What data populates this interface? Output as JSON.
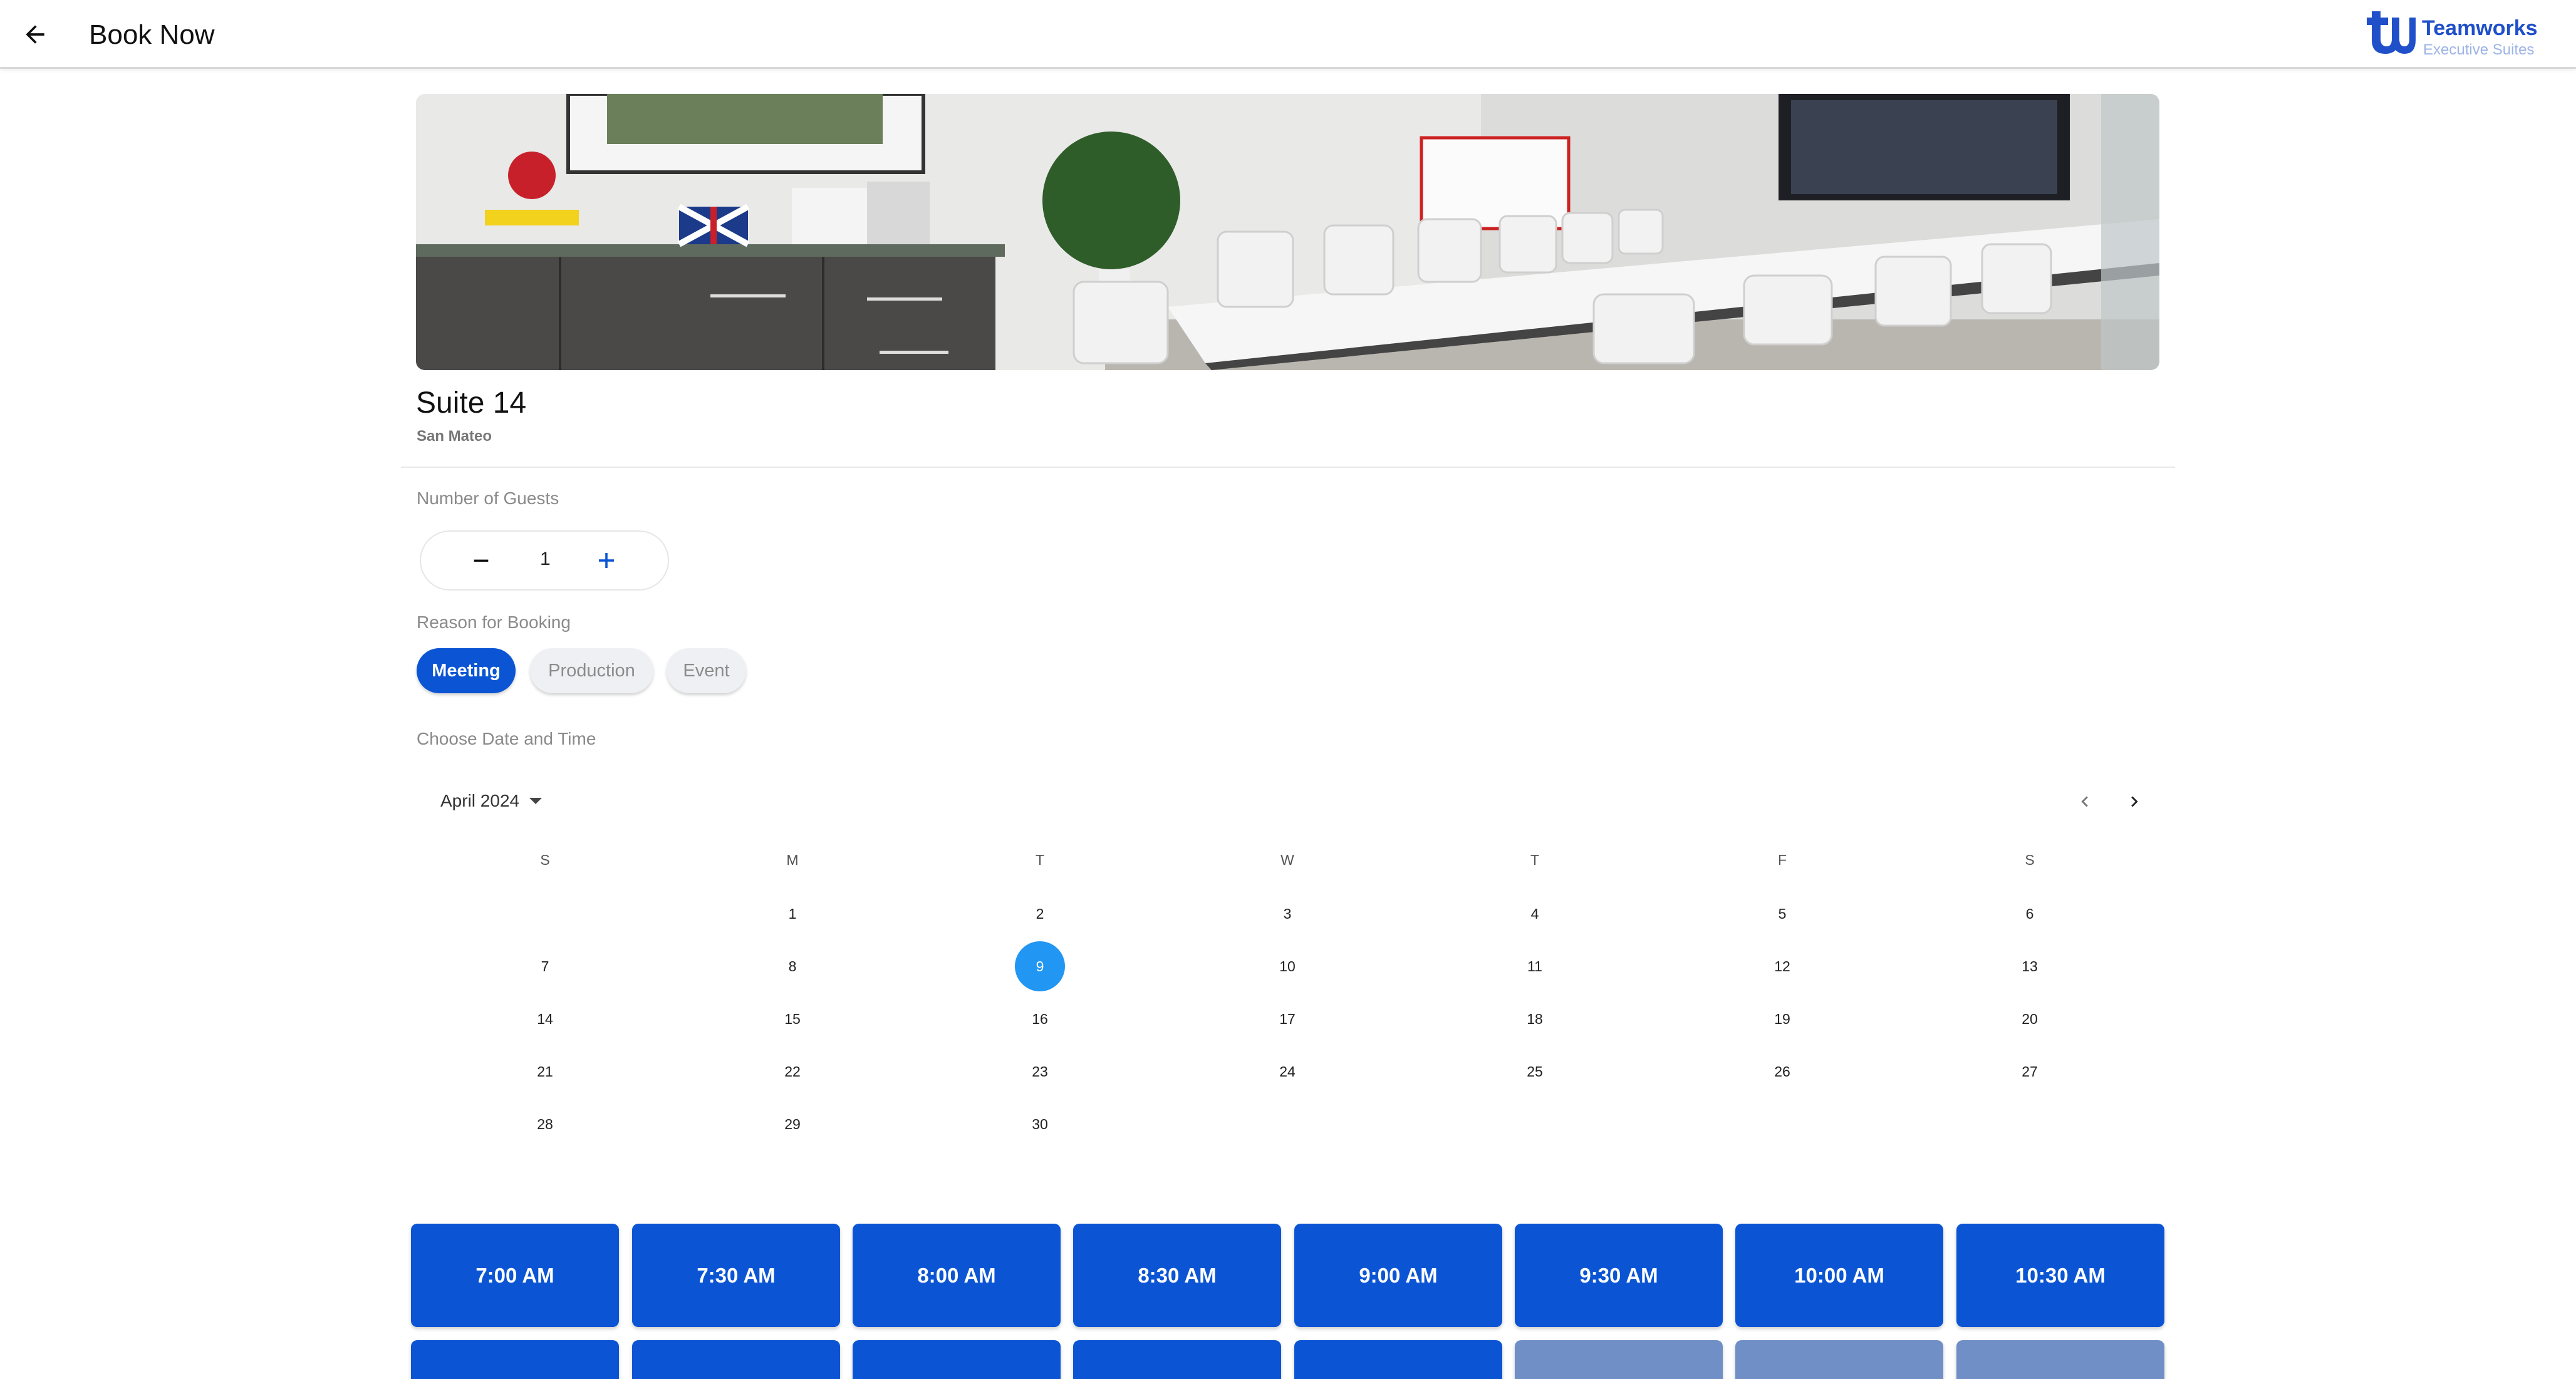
{
  "header": {
    "title": "Book Now",
    "back_icon": "arrow-left-icon",
    "logo": {
      "name": "Teamworks",
      "subtitle": "Executive Suites"
    }
  },
  "room": {
    "name": "Suite 14",
    "location": "San Mateo"
  },
  "guests": {
    "label": "Number of Guests",
    "value": "1"
  },
  "reason": {
    "label": "Reason for Booking",
    "options": [
      "Meeting",
      "Production",
      "Event"
    ],
    "selected": "Meeting"
  },
  "calendar": {
    "label": "Choose Date and Time",
    "month": "April 2024",
    "weekdays": [
      "S",
      "M",
      "T",
      "W",
      "T",
      "F",
      "S"
    ],
    "selected_day": 9,
    "days": [
      "1",
      "2",
      "3",
      "4",
      "5",
      "6",
      "7",
      "8",
      "9",
      "10",
      "11",
      "12",
      "13",
      "14",
      "15",
      "16",
      "17",
      "18",
      "19",
      "20",
      "21",
      "22",
      "23",
      "24",
      "25",
      "26",
      "27",
      "28",
      "29",
      "30"
    ]
  },
  "time_slots": [
    "7:00 AM",
    "7:30 AM",
    "8:00 AM",
    "8:30 AM",
    "9:00 AM",
    "9:30 AM",
    "10:00 AM",
    "10:30 AM"
  ],
  "colors": {
    "primary": "#0b55d4",
    "selected_day": "#2196f3",
    "disabled_slot": "#6f8fc6"
  }
}
